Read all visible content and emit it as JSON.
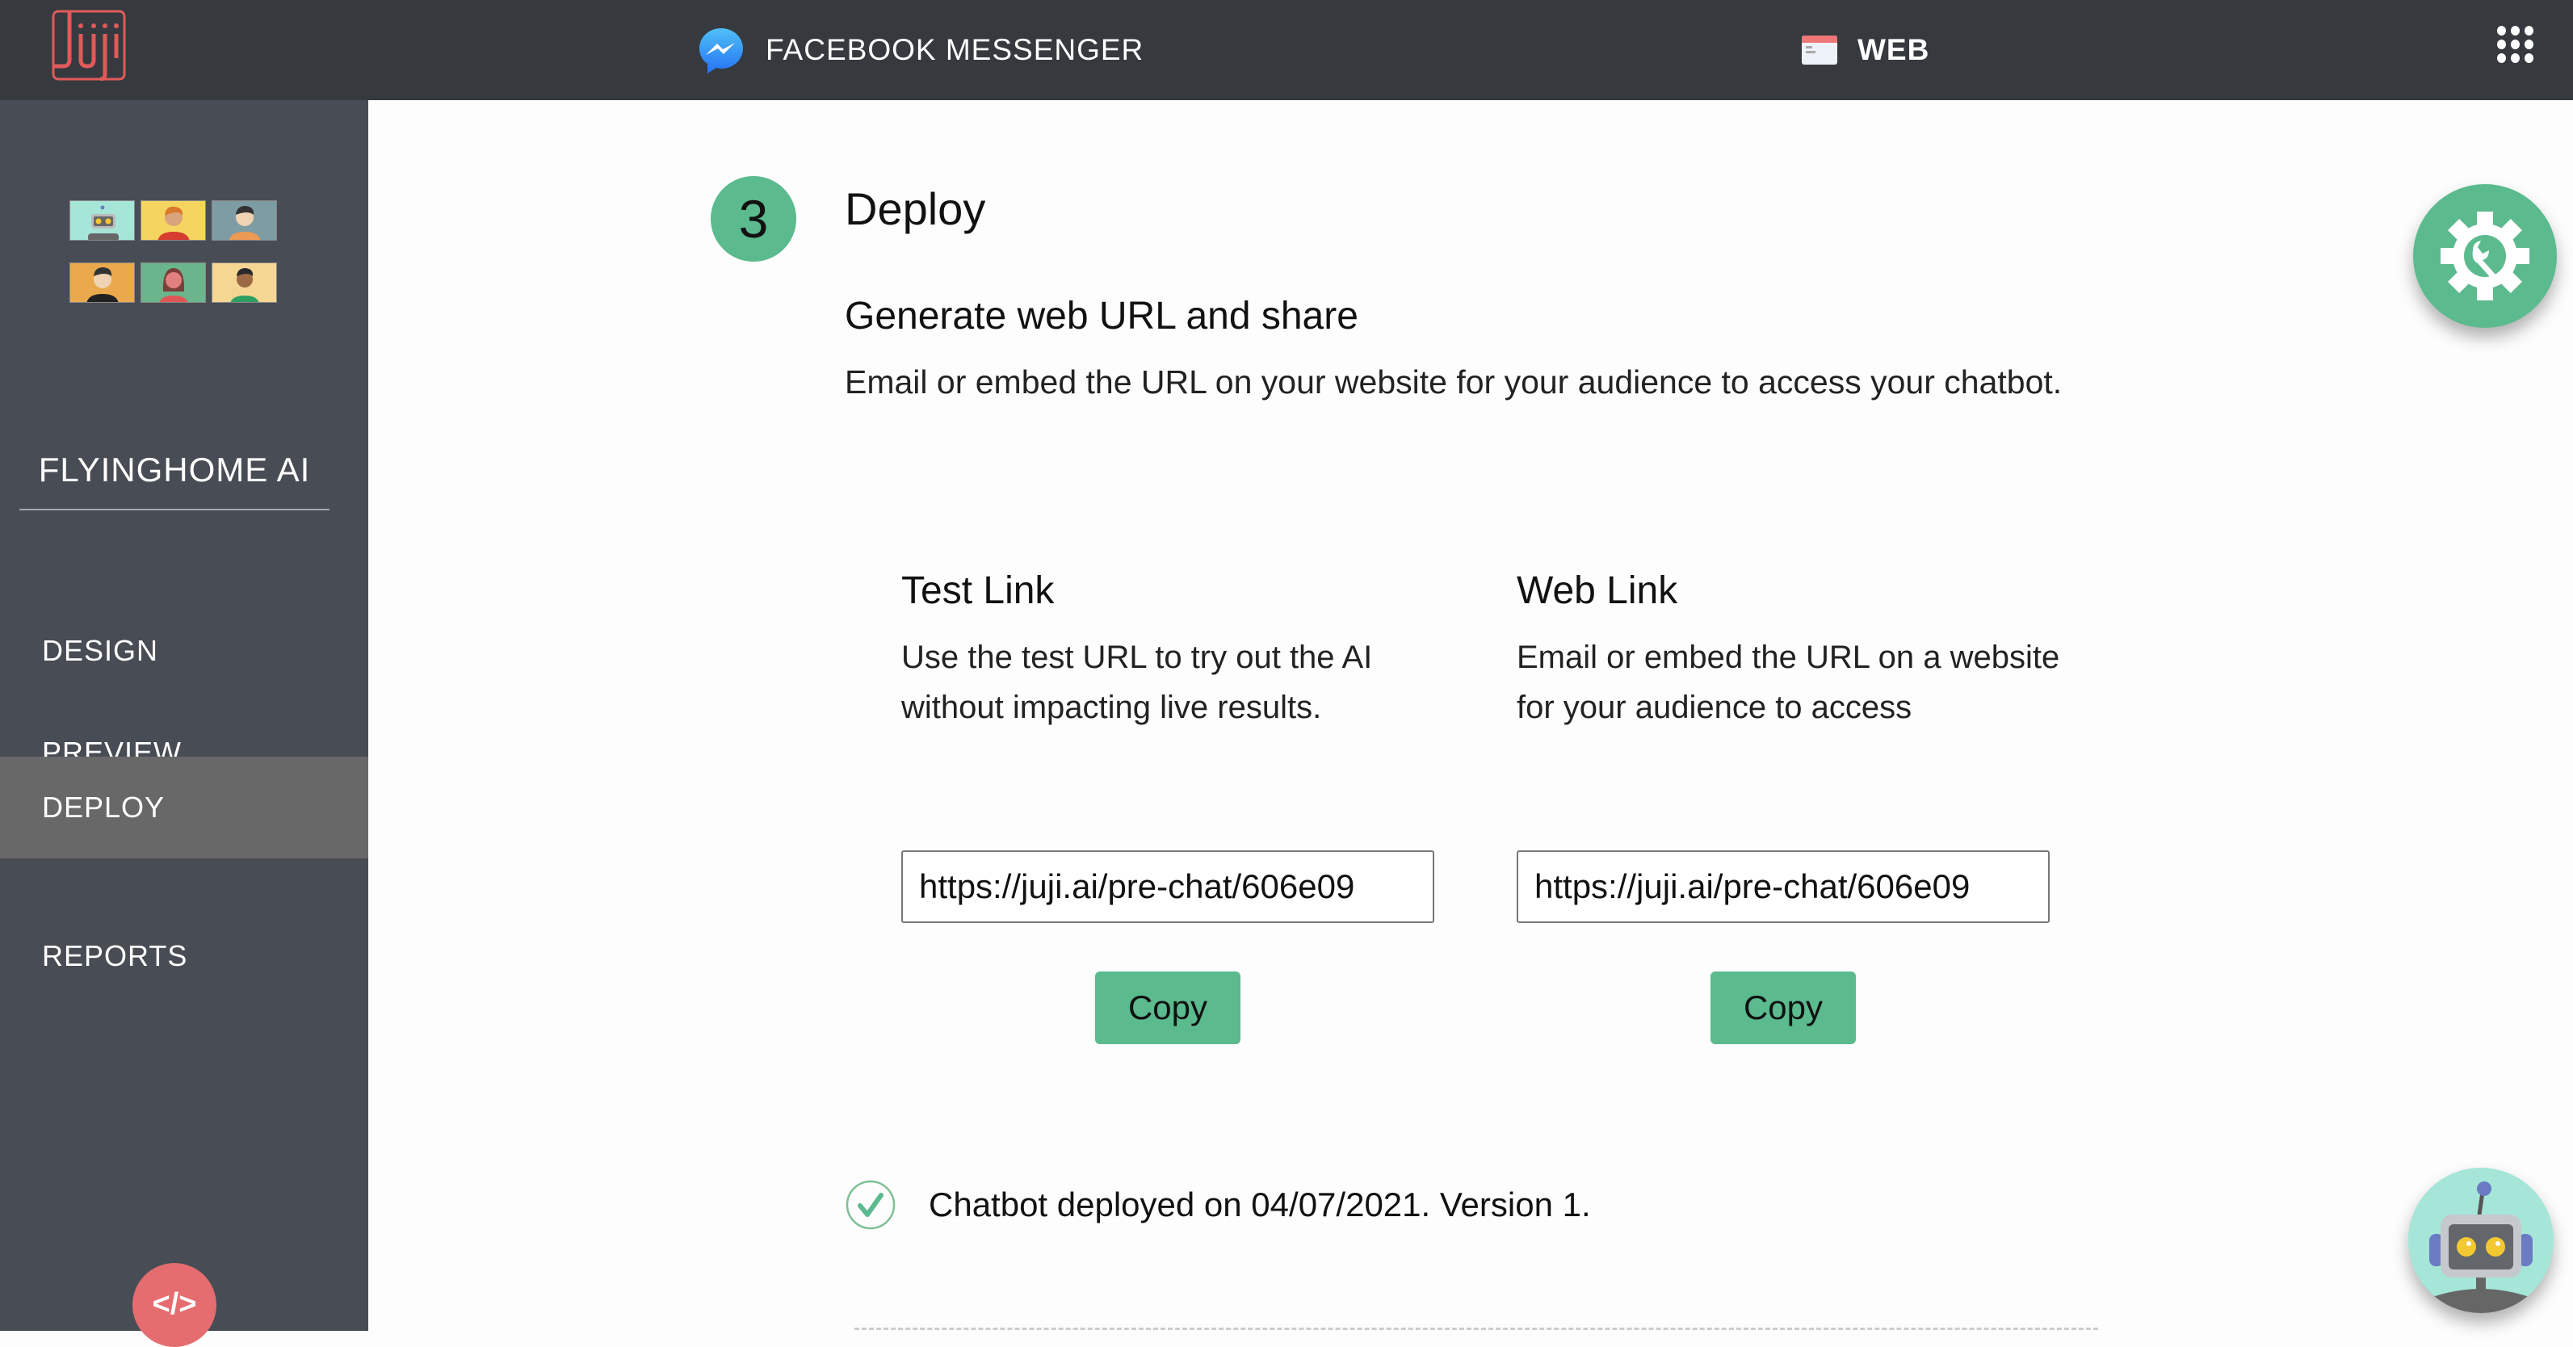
{
  "topbar": {
    "logo_text": "Juji",
    "tabs": [
      {
        "label": "FACEBOOK MESSENGER",
        "icon": "messenger-icon",
        "active": false
      },
      {
        "label": "WEB",
        "icon": "web-page-icon",
        "active": true
      }
    ],
    "apps_icon": "grid-dots-icon"
  },
  "sidebar": {
    "avatars": [
      {
        "name": "robot",
        "color": "#a5e6d8"
      },
      {
        "name": "woman-red-hair",
        "color": "#f5d55f"
      },
      {
        "name": "man-glasses",
        "color": "#7d9ca4"
      },
      {
        "name": "man-beard",
        "color": "#eba94e"
      },
      {
        "name": "woman-brown-hair",
        "color": "#6bb58c"
      },
      {
        "name": "woman-ponytail",
        "color": "#f5d693"
      }
    ],
    "project_name": "FLYINGHOME AI",
    "nav": [
      {
        "label": "DESIGN",
        "active": false
      },
      {
        "label": "PREVIEW",
        "active": false
      },
      {
        "label": "DEPLOY",
        "active": true
      },
      {
        "label": "REPORTS",
        "active": false
      }
    ],
    "embed_button_label": "</>"
  },
  "main": {
    "step_number": "3",
    "step_title": "Deploy",
    "section_title": "Generate web URL and share",
    "section_desc": "Email or embed the URL on your website for your audience to access your chatbot.",
    "test_link": {
      "title": "Test Link",
      "desc": "Use the test URL to try out the AI without impacting live results.",
      "url": "https://juji.ai/pre-chat/606e09",
      "copy_label": "Copy"
    },
    "web_link": {
      "title": "Web Link",
      "desc": "Email or embed the URL on a website for your audience to access",
      "url": "https://juji.ai/pre-chat/606e09",
      "copy_label": "Copy"
    },
    "status_text": "Chatbot deployed on 04/07/2021. Version 1."
  },
  "colors": {
    "topbar": "#363a3f",
    "sidebar": "#484c54",
    "sidebar_active": "#686868",
    "accent_green": "#5bba8e",
    "brand_red": "#e56d6f"
  }
}
